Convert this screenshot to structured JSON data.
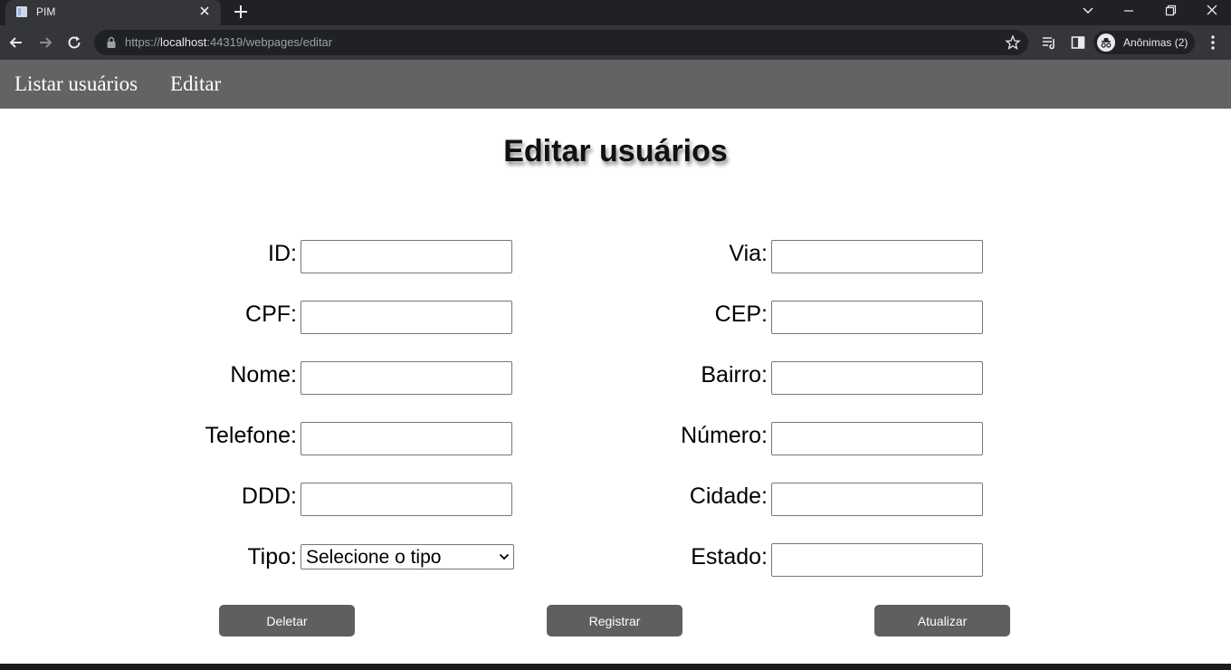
{
  "browser": {
    "tab_title": "PIM",
    "url_scheme": "https://",
    "url_host": "localhost",
    "url_rest": ":44319/webpages/editar",
    "profile_label": "Anônimas (2)"
  },
  "nav": {
    "items": [
      {
        "label": "Listar usuários"
      },
      {
        "label": "Editar"
      }
    ]
  },
  "page": {
    "title": "Editar usuários"
  },
  "form": {
    "left": [
      {
        "label": "ID:",
        "value": ""
      },
      {
        "label": "CPF:",
        "value": ""
      },
      {
        "label": "Nome:",
        "value": ""
      },
      {
        "label": "Telefone:",
        "value": ""
      },
      {
        "label": "DDD:",
        "value": ""
      },
      {
        "label": "Tipo:",
        "selected": "Selecione o tipo"
      }
    ],
    "right": [
      {
        "label": "Via:",
        "value": ""
      },
      {
        "label": "CEP:",
        "value": ""
      },
      {
        "label": "Bairro:",
        "value": ""
      },
      {
        "label": "Número:",
        "value": ""
      },
      {
        "label": "Cidade:",
        "value": ""
      },
      {
        "label": "Estado:",
        "value": ""
      }
    ]
  },
  "buttons": {
    "delete": "Deletar",
    "register": "Registrar",
    "update": "Atualizar"
  },
  "colors": {
    "nav_bg": "#636363",
    "button_bg": "#5f5f5f",
    "chrome_dark": "#202124",
    "chrome_toolbar": "#35363a"
  }
}
